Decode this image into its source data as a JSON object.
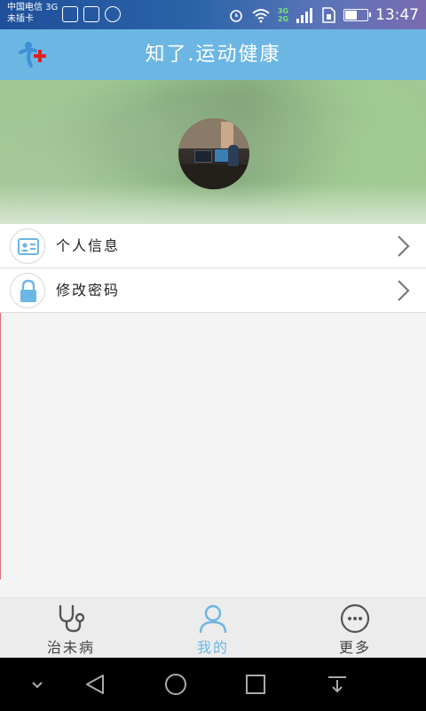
{
  "status_bar": {
    "carrier_line1": "中国电信 3G",
    "carrier_line2": "未插卡",
    "network_badge": "3G\n2G",
    "time": "13:47",
    "battery_level": 0.55,
    "left_icons": [
      "gallery-icon",
      "notification-icon",
      "sync-icon"
    ],
    "right_icons": [
      "alarm-icon",
      "wifi-icon",
      "signal-icon",
      "sim-icon",
      "battery-icon"
    ]
  },
  "header": {
    "title": "知了.运动健康",
    "logo_icon": "app-logo-icon",
    "color": "#6cb6e4"
  },
  "profile": {
    "avatar_icon": "avatar-photo"
  },
  "menu": {
    "items": [
      {
        "label": "个人信息",
        "icon": "id-card-icon"
      },
      {
        "label": "修改密码",
        "icon": "lock-icon"
      }
    ]
  },
  "tabs": {
    "items": [
      {
        "label": "治未病",
        "icon": "stethoscope-icon",
        "active": false
      },
      {
        "label": "我的",
        "icon": "user-icon",
        "active": true
      },
      {
        "label": "更多",
        "icon": "more-icon",
        "active": false
      }
    ],
    "active_color": "#6cb6e4",
    "inactive_color": "#444444"
  },
  "nav_bar": {
    "buttons": [
      "collapse-icon",
      "back-icon",
      "home-icon",
      "recents-icon",
      "notification-pull-icon"
    ]
  }
}
